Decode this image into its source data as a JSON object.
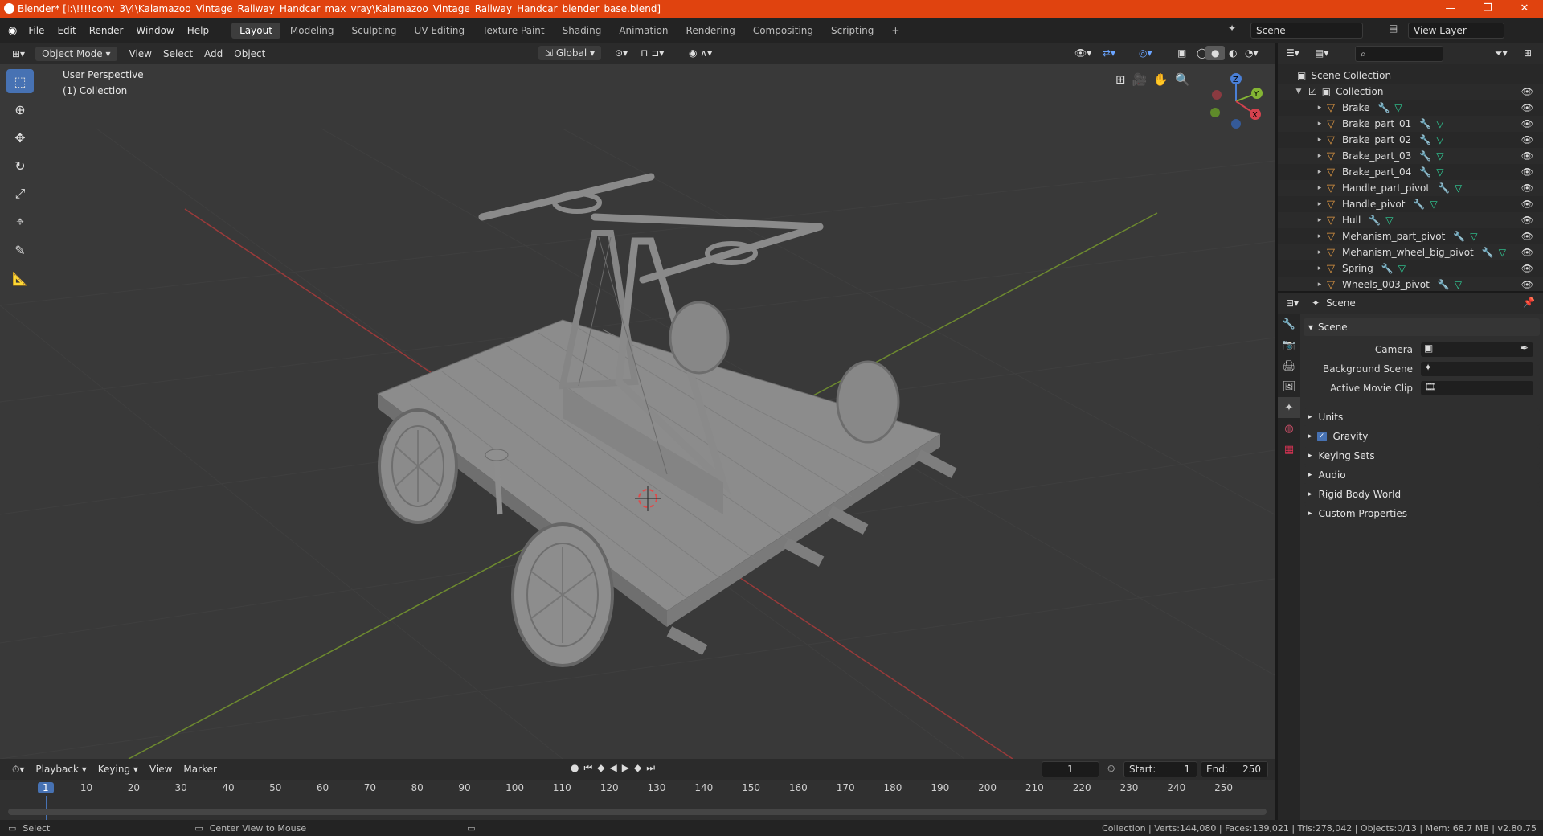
{
  "window": {
    "title": "Blender* [I:\\!!!!conv_3\\4\\Kalamazoo_Vintage_Railway_Handcar_max_vray\\Kalamazoo_Vintage_Railway_Handcar_blender_base.blend]",
    "minimize": "—",
    "maximize": "❐",
    "close": "✕"
  },
  "menu": {
    "items": [
      "File",
      "Edit",
      "Render",
      "Window",
      "Help"
    ]
  },
  "workspaces": [
    "Layout",
    "Modeling",
    "Sculpting",
    "UV Editing",
    "Texture Paint",
    "Shading",
    "Animation",
    "Rendering",
    "Compositing",
    "Scripting"
  ],
  "workspace_add": "+",
  "scene_selector": {
    "value": "Scene"
  },
  "view_layer_selector": {
    "value": "View Layer"
  },
  "viewport_header": {
    "mode": "Object Mode",
    "menus": [
      "View",
      "Select",
      "Add",
      "Object"
    ],
    "orientation": "Global"
  },
  "viewport": {
    "perspective_label": "User Perspective",
    "collection_label": "(1) Collection",
    "gizmo_axes": {
      "x": "X",
      "y": "Y",
      "z": "Z"
    }
  },
  "tools": [
    "select-box",
    "cursor",
    "move",
    "rotate",
    "scale",
    "transform",
    "annotate",
    "measure"
  ],
  "outliner": {
    "root": "Scene Collection",
    "collection": "Collection",
    "objects": [
      "Brake",
      "Brake_part_01",
      "Brake_part_02",
      "Brake_part_03",
      "Brake_part_04",
      "Handle_part_pivot",
      "Handle_pivot",
      "Hull",
      "Mehanism_part_pivot",
      "Mehanism_wheel_big_pivot",
      "Spring",
      "Wheels_003_pivot"
    ]
  },
  "properties": {
    "context": "Scene",
    "panel_title": "Scene",
    "fields": [
      {
        "label": "Camera"
      },
      {
        "label": "Background Scene"
      },
      {
        "label": "Active Movie Clip"
      }
    ],
    "sections": [
      "Units",
      "Gravity",
      "Keying Sets",
      "Audio",
      "Rigid Body World",
      "Custom Properties"
    ]
  },
  "timeline": {
    "menus": [
      "Playback",
      "Keying",
      "View",
      "Marker"
    ],
    "current_frame": "1",
    "start_label": "Start:",
    "start": "1",
    "end_label": "End:",
    "end": "250",
    "ticks": [
      "1",
      "10",
      "20",
      "30",
      "40",
      "50",
      "60",
      "70",
      "80",
      "90",
      "100",
      "110",
      "120",
      "130",
      "140",
      "150",
      "160",
      "170",
      "180",
      "190",
      "200",
      "210",
      "220",
      "230",
      "240",
      "250"
    ]
  },
  "status": {
    "select": "Select",
    "center_view": "Center View to Mouse",
    "stats": "Collection | Verts:144,080 | Faces:139,021 | Tris:278,042 | Objects:0/13 | Mem: 68.7 MB | v2.80.75"
  },
  "colors": {
    "accent": "#4772b3",
    "titlebar": "#e0430f",
    "object_icon": "#e39a43",
    "mesh_icon": "#2fd39a"
  }
}
